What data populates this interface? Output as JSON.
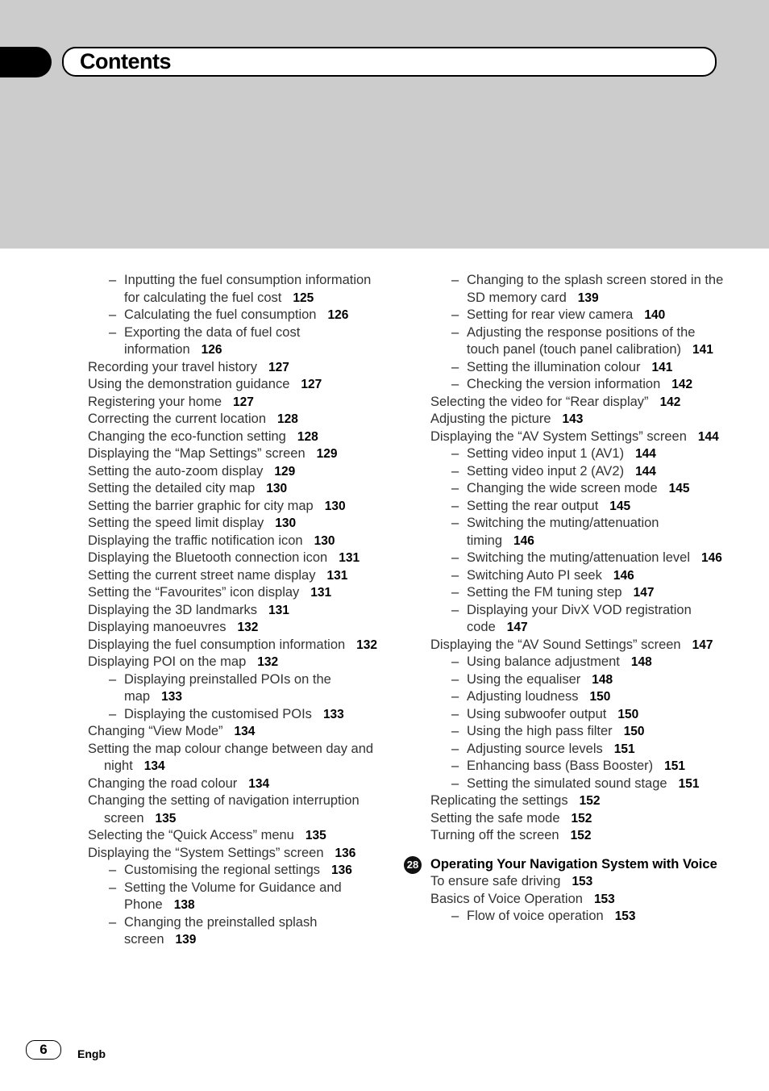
{
  "header": {
    "title": "Contents"
  },
  "footer": {
    "page_number": "6",
    "language": "Engb"
  },
  "left_column": [
    {
      "level": 2,
      "text": "Inputting the fuel consumption information for calculating the fuel cost",
      "page": "125"
    },
    {
      "level": 2,
      "text": "Calculating the fuel consumption",
      "page": "126"
    },
    {
      "level": 2,
      "text": "Exporting the data of fuel cost information",
      "page": "126"
    },
    {
      "level": 1,
      "text": "Recording your travel history",
      "page": "127"
    },
    {
      "level": 1,
      "text": "Using the demonstration guidance",
      "page": "127"
    },
    {
      "level": 1,
      "text": "Registering your home",
      "page": "127"
    },
    {
      "level": 1,
      "text": "Correcting the current location",
      "page": "128"
    },
    {
      "level": 1,
      "text": "Changing the eco-function setting",
      "page": "128"
    },
    {
      "level": 1,
      "text": "Displaying the “Map Settings” screen",
      "page": "129"
    },
    {
      "level": 1,
      "text": "Setting the auto-zoom display",
      "page": "129"
    },
    {
      "level": 1,
      "text": "Setting the detailed city map",
      "page": "130"
    },
    {
      "level": 1,
      "text": "Setting the barrier graphic for city map",
      "page": "130"
    },
    {
      "level": 1,
      "text": "Setting the speed limit display",
      "page": "130"
    },
    {
      "level": 1,
      "text": "Displaying the traffic notification icon",
      "page": "130"
    },
    {
      "level": 1,
      "text": "Displaying the Bluetooth connection icon",
      "page": "131"
    },
    {
      "level": 1,
      "text": "Setting the current street name display",
      "page": "131"
    },
    {
      "level": 1,
      "text": "Setting the “Favourites” icon display",
      "page": "131"
    },
    {
      "level": 1,
      "text": "Displaying the 3D landmarks",
      "page": "131"
    },
    {
      "level": 1,
      "text": "Displaying manoeuvres",
      "page": "132"
    },
    {
      "level": 1,
      "text": "Displaying the fuel consumption information",
      "page": "132"
    },
    {
      "level": 1,
      "text": "Displaying POI on the map",
      "page": "132"
    },
    {
      "level": 2,
      "text": "Displaying preinstalled POIs on the map",
      "page": "133"
    },
    {
      "level": 2,
      "text": "Displaying the customised POIs",
      "page": "133"
    },
    {
      "level": 1,
      "text": "Changing “View Mode”",
      "page": "134"
    },
    {
      "level": 1,
      "text": "Setting the map colour change between day and night",
      "page": "134"
    },
    {
      "level": 1,
      "text": "Changing the road colour",
      "page": "134"
    },
    {
      "level": 1,
      "text": "Changing the setting of navigation interruption screen",
      "page": "135"
    },
    {
      "level": 1,
      "text": "Selecting the “Quick Access” menu",
      "page": "135"
    },
    {
      "level": 1,
      "text": "Displaying the “System Settings” screen",
      "page": "136"
    },
    {
      "level": 2,
      "text": "Customising the regional settings",
      "page": "136"
    },
    {
      "level": 2,
      "text": "Setting the Volume for Guidance and Phone",
      "page": "138"
    },
    {
      "level": 2,
      "text": "Changing the preinstalled splash screen",
      "page": "139"
    }
  ],
  "right_column": [
    {
      "level": 2,
      "text": "Changing to the splash screen stored in the SD memory card",
      "page": "139"
    },
    {
      "level": 2,
      "text": "Setting for rear view camera",
      "page": "140"
    },
    {
      "level": 2,
      "text": "Adjusting the response positions of the touch panel (touch panel calibration)",
      "page": "141"
    },
    {
      "level": 2,
      "text": "Setting the illumination colour",
      "page": "141"
    },
    {
      "level": 2,
      "text": "Checking the version information",
      "page": "142"
    },
    {
      "level": 1,
      "text": "Selecting the video for “Rear display”",
      "page": "142"
    },
    {
      "level": 1,
      "text": "Adjusting the picture",
      "page": "143"
    },
    {
      "level": 1,
      "text": "Displaying the “AV System Settings” screen",
      "page": "144"
    },
    {
      "level": 2,
      "text": "Setting video input 1 (AV1)",
      "page": "144"
    },
    {
      "level": 2,
      "text": "Setting video input 2 (AV2)",
      "page": "144"
    },
    {
      "level": 2,
      "text": "Changing the wide screen mode",
      "page": "145"
    },
    {
      "level": 2,
      "text": "Setting the rear output",
      "page": "145"
    },
    {
      "level": 2,
      "text": "Switching the muting/attenuation timing",
      "page": "146"
    },
    {
      "level": 2,
      "text": "Switching the muting/attenuation level",
      "page": "146"
    },
    {
      "level": 2,
      "text": "Switching Auto PI seek",
      "page": "146"
    },
    {
      "level": 2,
      "text": "Setting the FM tuning step",
      "page": "147"
    },
    {
      "level": 2,
      "text": "Displaying your DivX VOD registration code",
      "page": "147"
    },
    {
      "level": 1,
      "text": "Displaying the “AV Sound Settings” screen",
      "page": "147"
    },
    {
      "level": 2,
      "text": "Using balance adjustment",
      "page": "148"
    },
    {
      "level": 2,
      "text": "Using the equaliser",
      "page": "148"
    },
    {
      "level": 2,
      "text": "Adjusting loudness",
      "page": "150"
    },
    {
      "level": 2,
      "text": "Using subwoofer output",
      "page": "150"
    },
    {
      "level": 2,
      "text": "Using the high pass filter",
      "page": "150"
    },
    {
      "level": 2,
      "text": "Adjusting source levels",
      "page": "151"
    },
    {
      "level": 2,
      "text": "Enhancing bass (Bass Booster)",
      "page": "151"
    },
    {
      "level": 2,
      "text": "Setting the simulated sound stage",
      "page": "151"
    },
    {
      "level": 1,
      "text": "Replicating the settings",
      "page": "152"
    },
    {
      "level": 1,
      "text": "Setting the safe mode",
      "page": "152"
    },
    {
      "level": 1,
      "text": "Turning off the screen",
      "page": "152"
    }
  ],
  "chapter": {
    "number": "28",
    "title": "Operating Your Navigation System with Voice",
    "entries": [
      {
        "level": 1,
        "text": "To ensure safe driving",
        "page": "153"
      },
      {
        "level": 1,
        "text": "Basics of Voice Operation",
        "page": "153"
      },
      {
        "level": 2,
        "text": "Flow of voice operation",
        "page": "153"
      }
    ]
  },
  "dash_glyph": "–"
}
